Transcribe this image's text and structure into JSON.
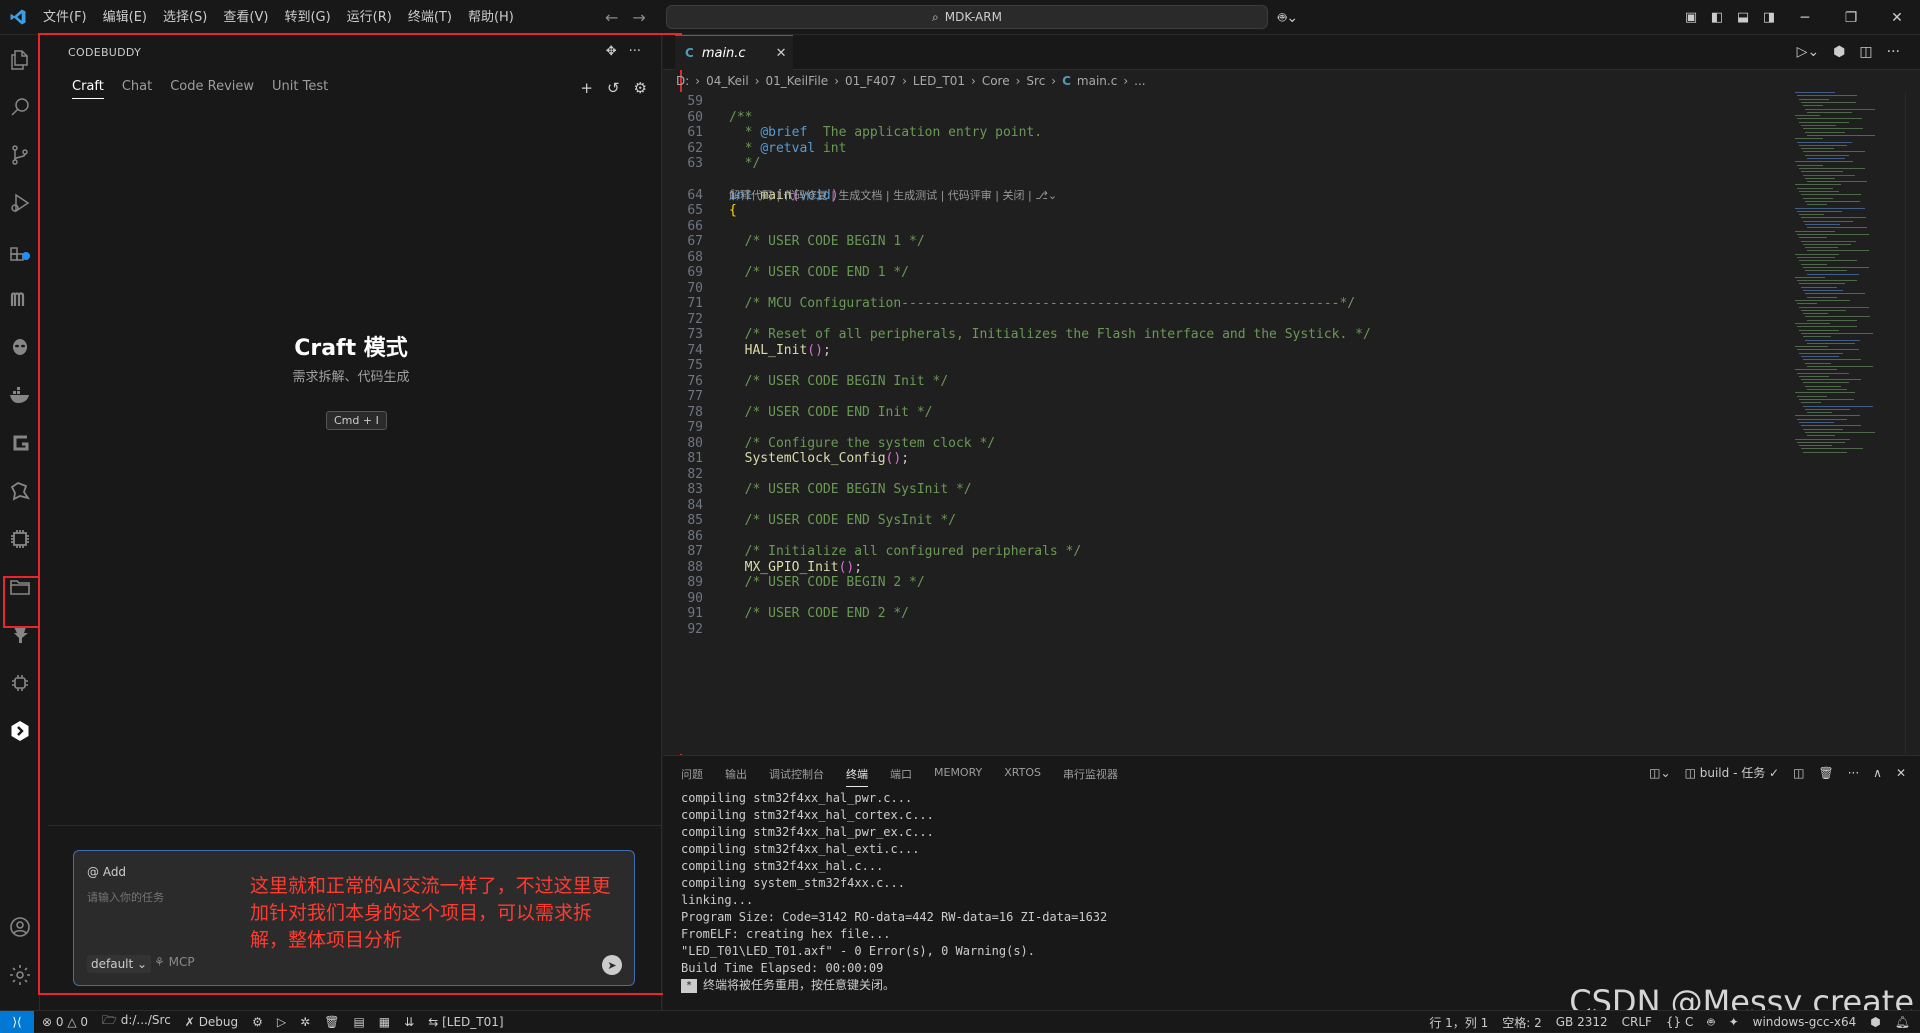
{
  "menu": [
    "文件(F)",
    "编辑(E)",
    "选择(S)",
    "查看(V)",
    "转到(G)",
    "运行(R)",
    "终端(T)",
    "帮助(H)"
  ],
  "search": {
    "label": "MDK-ARM"
  },
  "sidepanel": {
    "header": "CODEBUDDY",
    "tabs": [
      "Craft",
      "Chat",
      "Code Review",
      "Unit Test"
    ],
    "craft_title": "Craft 模式",
    "craft_sub": "需求拆解、代码生成",
    "shortcut": "Cmd + I",
    "chat": {
      "add": "@ Add",
      "placeholder": "请输入你的任务",
      "model": "default",
      "mcp": "MCP",
      "note": "这里就和正常的AI交流一样了，不过这里更加针对我们本身的这个项目，可以需求拆解，整体项目分析"
    }
  },
  "editor": {
    "tab": "main.c",
    "breadcrumb": [
      "D:",
      "04_Keil",
      "01_KeilFile",
      "01_F407",
      "LED_T01",
      "Core",
      "Src",
      "main.c",
      "..."
    ],
    "codelens": "解释代码 | 代码修复 | 生成文档 | 生成测试 | 代码评审 | 关闭 |",
    "lines": [
      {
        "n": "59",
        "t": ""
      },
      {
        "n": "60",
        "t": "/**"
      },
      {
        "n": "61",
        "t": "  * @brief  The application entry point."
      },
      {
        "n": "62",
        "t": "  * @retval int"
      },
      {
        "n": "63",
        "t": "  */"
      },
      {
        "n": "64",
        "t": "int main(void)"
      },
      {
        "n": "65",
        "t": "{"
      },
      {
        "n": "66",
        "t": ""
      },
      {
        "n": "67",
        "t": "  /* USER CODE BEGIN 1 */"
      },
      {
        "n": "68",
        "t": ""
      },
      {
        "n": "69",
        "t": "  /* USER CODE END 1 */"
      },
      {
        "n": "70",
        "t": ""
      },
      {
        "n": "71",
        "t": "  /* MCU Configuration--------------------------------------------------------*/"
      },
      {
        "n": "72",
        "t": ""
      },
      {
        "n": "73",
        "t": "  /* Reset of all peripherals, Initializes the Flash interface and the Systick. */"
      },
      {
        "n": "74",
        "t": "  HAL_Init();"
      },
      {
        "n": "75",
        "t": ""
      },
      {
        "n": "76",
        "t": "  /* USER CODE BEGIN Init */"
      },
      {
        "n": "77",
        "t": ""
      },
      {
        "n": "78",
        "t": "  /* USER CODE END Init */"
      },
      {
        "n": "79",
        "t": ""
      },
      {
        "n": "80",
        "t": "  /* Configure the system clock */"
      },
      {
        "n": "81",
        "t": "  SystemClock_Config();"
      },
      {
        "n": "82",
        "t": ""
      },
      {
        "n": "83",
        "t": "  /* USER CODE BEGIN SysInit */"
      },
      {
        "n": "84",
        "t": ""
      },
      {
        "n": "85",
        "t": "  /* USER CODE END SysInit */"
      },
      {
        "n": "86",
        "t": ""
      },
      {
        "n": "87",
        "t": "  /* Initialize all configured peripherals */"
      },
      {
        "n": "88",
        "t": "  MX_GPIO_Init();"
      },
      {
        "n": "89",
        "t": "  /* USER CODE BEGIN 2 */"
      },
      {
        "n": "90",
        "t": ""
      },
      {
        "n": "91",
        "t": "  /* USER CODE END 2 */"
      },
      {
        "n": "92",
        "t": ""
      }
    ]
  },
  "panel": {
    "tabs": [
      "问题",
      "输出",
      "调试控制台",
      "终端",
      "端口",
      "MEMORY",
      "XRTOS",
      "串行监视器"
    ],
    "active_tab": "终端",
    "task": "build - 任务",
    "terminal": [
      "compiling stm32f4xx_hal_pwr.c...",
      "compiling stm32f4xx_hal_cortex.c...",
      "compiling stm32f4xx_hal_pwr_ex.c...",
      "compiling stm32f4xx_hal_exti.c...",
      "compiling stm32f4xx_hal.c...",
      "compiling system_stm32f4xx.c...",
      "linking...",
      "Program Size: Code=3142 RO-data=442 RW-data=16 ZI-data=1632",
      "FromELF: creating hex file...",
      "\"LED_T01\\LED_T01.axf\" - 0 Error(s), 0 Warning(s).",
      "Build Time Elapsed:  00:00:09"
    ],
    "terminal_last": "终端将被任务重用，按任意键关闭。"
  },
  "watermark": "CSDN @Messy create",
  "statusbar": {
    "errors": "⊗ 0 △ 0",
    "folder": "d:/.../Src",
    "debug": "Debug",
    "target": "[LED_T01]",
    "position": "行 1，列 1",
    "spaces": "空格: 2",
    "encoding": "GB 2312",
    "eol": "CRLF",
    "lang": "{} C",
    "platform": "windows-gcc-x64"
  },
  "colors": {
    "accent": "#0078d4",
    "highlight": "#e8262c",
    "annotation": "#ff3b30"
  }
}
